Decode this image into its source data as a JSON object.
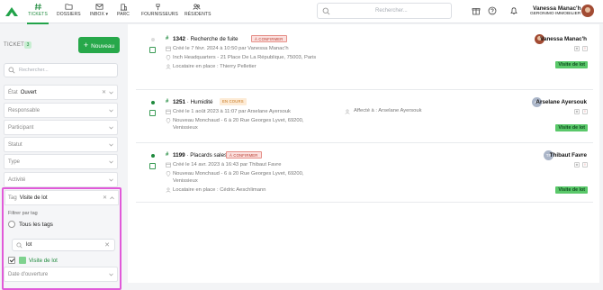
{
  "topbar": {
    "nav": [
      {
        "label": "TICKETS",
        "icon": "hash-icon",
        "active": true
      },
      {
        "label": "DOSSIERS",
        "icon": "folder-icon"
      },
      {
        "label": "INBOX",
        "icon": "inbox-icon"
      },
      {
        "label": "PARC",
        "icon": "building-icon"
      },
      {
        "label": "FOURNISSEURS",
        "icon": "pin-icon"
      },
      {
        "label": "RÉSIDENTS",
        "icon": "people-icon"
      }
    ],
    "search_placeholder": "Rechercher...",
    "user_name": "Vanessa Manac'h",
    "user_org": "GERONIMO IMMOBILIER"
  },
  "sidebar": {
    "tickets_label": "TICKETS",
    "tickets_count": "3",
    "new_button": "Nouveau",
    "search_placeholder": "Rechercher...",
    "filters": [
      {
        "label": "État",
        "value": "Ouvert"
      },
      {
        "label": "Responsable",
        "value": ""
      },
      {
        "label": "Participant",
        "value": ""
      },
      {
        "label": "Statut",
        "value": ""
      },
      {
        "label": "Type",
        "value": ""
      },
      {
        "label": "Activité",
        "value": ""
      }
    ],
    "tag_filter": {
      "label": "Tag",
      "value": "Visite de lot",
      "filter_by": "Filtrer par tag",
      "all_tags": "Tous les tags",
      "query": "lot",
      "option": "Visite de lot",
      "option_color": "#7fd28f"
    },
    "date_filter": "Date d'ouverture"
  },
  "tickets": [
    {
      "id": "1342",
      "title": "Recherche de fuite",
      "status": "À CONFIRMER",
      "status_style": "red",
      "created": "Créé le 7 févr. 2024 à 10:50 par Vanessa Manac'h",
      "address": "Inch Headquarters - 21 Place De La République, 75003, Paris",
      "occupant": "Locataire en place : Thierry Pelletier",
      "assignee": "Vanessa Manac'h",
      "assignee_initials": "",
      "tag": "Visite de lot",
      "unread": false
    },
    {
      "id": "1251",
      "title": "Humidité",
      "status": "EN COURS",
      "status_style": "orange",
      "created": "Créé le 1 août 2023 à 11:07 par Arselane Ayersouk",
      "address": "Nouveau Monchaud - 6 à 20 Rue Georges Lyvet, 69200, Venissieux",
      "occupant": "",
      "affected": "Affecté à : Arselane Ayersouk",
      "assignee": "Arselane Ayersouk",
      "assignee_initials": "AA",
      "tag": "Visite de lot",
      "unread": true
    },
    {
      "id": "1199",
      "title": "Placards sales",
      "status": "À CONFIRMER",
      "status_style": "red",
      "created": "Créé le 14 avr. 2023 à 16:43 par Thibaut Favre",
      "address": "Nouveau Monchaud - 6 à 20 Rue Georges Lyvet, 69200, Venissieux",
      "occupant": "Locataire en place : Cédric Aeschlimann",
      "assignee": "Thibaut Favre",
      "assignee_initials": "TF",
      "tag": "Visite de lot",
      "unread": true
    }
  ]
}
